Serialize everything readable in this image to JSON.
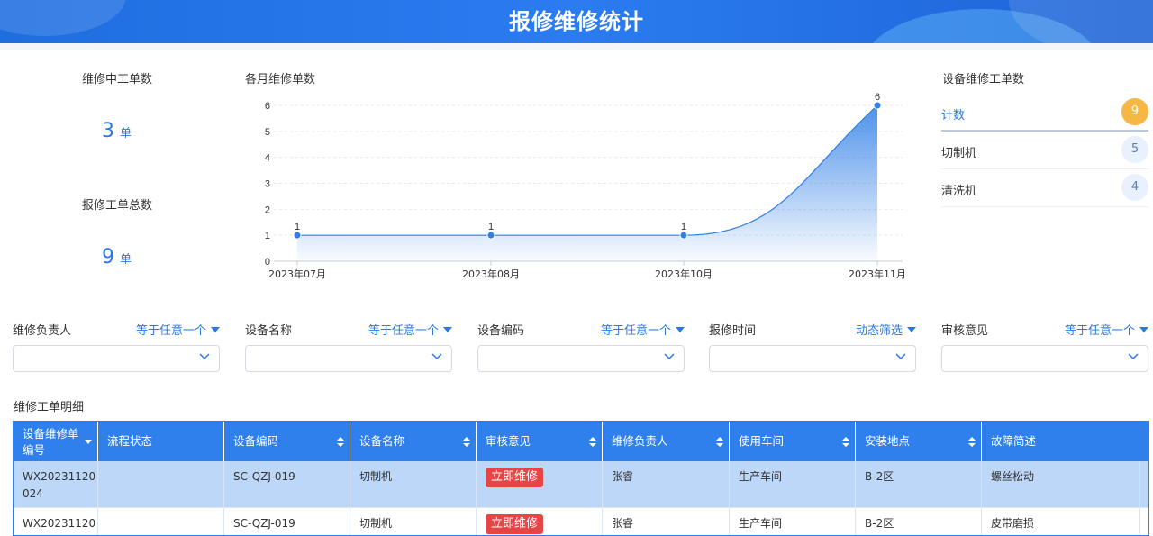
{
  "header": {
    "title": "报修维修统计"
  },
  "kpis": [
    {
      "label": "维修中工单数",
      "value": "3",
      "unit": "单"
    },
    {
      "label": "报修工单总数",
      "value": "9",
      "unit": "单"
    }
  ],
  "chart_data": {
    "type": "area",
    "title": "各月维修单数",
    "categories": [
      "2023年07月",
      "2023年08月",
      "2023年10月",
      "2023年11月"
    ],
    "values": [
      1,
      1,
      1,
      6
    ],
    "ylim": [
      0,
      6
    ],
    "yticks": [
      0,
      1,
      2,
      3,
      4,
      5,
      6
    ],
    "grid": true,
    "color": "#2f7fe6"
  },
  "rank": {
    "title": "设备维修工单数",
    "rows": [
      {
        "label": "计数",
        "count": "9"
      },
      {
        "label": "切制机",
        "count": "5"
      },
      {
        "label": "清洗机",
        "count": "4"
      }
    ]
  },
  "filters": [
    {
      "label": "维修负责人",
      "mode": "等于任意一个"
    },
    {
      "label": "设备名称",
      "mode": "等于任意一个"
    },
    {
      "label": "设备编码",
      "mode": "等于任意一个"
    },
    {
      "label": "报修时间",
      "mode": "动态筛选"
    },
    {
      "label": "审核意见",
      "mode": "等于任意一个"
    }
  ],
  "table": {
    "title": "维修工单明细",
    "columns": [
      {
        "line1": "设备维修单",
        "line2": "编号"
      },
      {
        "line1": "流程状态",
        "line2": ""
      },
      {
        "line1": "设备编码",
        "line2": ""
      },
      {
        "line1": "设备名称",
        "line2": ""
      },
      {
        "line1": "审核意见",
        "line2": ""
      },
      {
        "line1": "维修负责人",
        "line2": ""
      },
      {
        "line1": "使用车间",
        "line2": ""
      },
      {
        "line1": "安装地点",
        "line2": ""
      },
      {
        "line1": "故障简述",
        "line2": ""
      }
    ],
    "rows": [
      {
        "id_line1": "WX20231120",
        "id_line2": "024",
        "status": "",
        "code": "SC-QZJ-019",
        "name": "切制机",
        "review": "立即维修",
        "owner": "张睿",
        "workshop": "生产车间",
        "location": "B-2区",
        "fault": "螺丝松动"
      },
      {
        "id_line1": "WX20231120",
        "id_line2": "",
        "status": "",
        "code": "SC-QZJ-019",
        "name": "切制机",
        "review": "立即维修",
        "owner": "张睿",
        "workshop": "生产车间",
        "location": "B-2区",
        "fault": "皮带磨损"
      }
    ]
  }
}
